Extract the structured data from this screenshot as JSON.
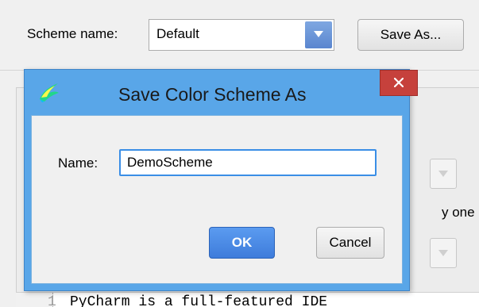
{
  "background": {
    "scheme_label": "Scheme name:",
    "scheme_value": "Default",
    "save_as_label": "Save As...",
    "snippet_text": "y one",
    "editor": {
      "line_number": "1",
      "code_line": "PyCharm is a full-featured IDE"
    }
  },
  "dialog": {
    "title": "Save Color Scheme As",
    "name_label": "Name:",
    "name_value": "DemoScheme",
    "ok_label": "OK",
    "cancel_label": "Cancel"
  },
  "icons": {
    "app": "pycharm-app-icon",
    "close": "close-icon",
    "dropdown": "chevron-down-icon"
  },
  "colors": {
    "dialog_frame": "#59a6e8",
    "close_button": "#c6413c",
    "ok_button": "#3e7cdb",
    "focus_border": "#3a8ee6"
  }
}
